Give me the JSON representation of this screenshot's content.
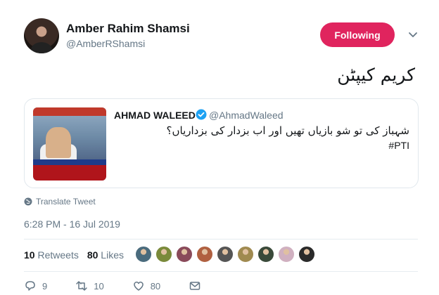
{
  "author": {
    "name": "Amber Rahim Shamsi",
    "handle": "@AmberRShamsi"
  },
  "follow_button": {
    "label": "Following",
    "color": "#e0245e"
  },
  "tweet": {
    "text": "کریم کیپٹن",
    "translate_label": "Translate Tweet",
    "timestamp": "6:28 PM - 16 Jul 2019"
  },
  "quoted": {
    "name": "AHMAD WALEED",
    "handle": "@AhmadWaleed",
    "text": "شہباز کی تو شو بازیاں تھیں اور اب بزدار کی بزداریاں؟",
    "hashtag": "#PTI"
  },
  "stats": {
    "retweets_count": "10",
    "retweets_label": "Retweets",
    "likes_count": "80",
    "likes_label": "Likes"
  },
  "liker_colors": [
    "#4a6b7d",
    "#7a8a3a",
    "#8a4a5a",
    "#b06040",
    "#555555",
    "#a08a50",
    "#3a4a3a",
    "#d0b0c0",
    "#2a2a2a"
  ],
  "actions": {
    "replies": "9",
    "retweets": "10",
    "likes": "80"
  }
}
